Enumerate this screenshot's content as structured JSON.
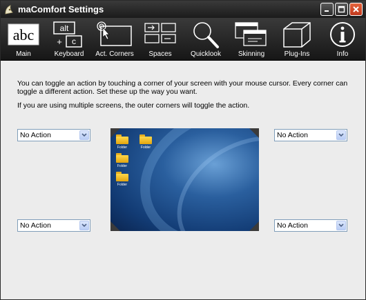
{
  "window": {
    "title": "maComfort Settings"
  },
  "toolbar": {
    "items": [
      {
        "label": "Main",
        "icon": "abc-text-icon"
      },
      {
        "label": "Keyboard",
        "icon": "keyboard-shortcut-icon"
      },
      {
        "label": "Act. Corners",
        "icon": "screen-corner-cursor-icon"
      },
      {
        "label": "Spaces",
        "icon": "spaces-icon"
      },
      {
        "label": "Quicklook",
        "icon": "magnifier-icon"
      },
      {
        "label": "Skinning",
        "icon": "skinning-windows-icon"
      },
      {
        "label": "Plug-Ins",
        "icon": "cube-icon"
      },
      {
        "label": "Info",
        "icon": "info-icon"
      }
    ],
    "main_icon_text": "abc",
    "keyboard_key1": "alt",
    "keyboard_plus": "+",
    "keyboard_key2": "c"
  },
  "content": {
    "paragraph1": "You can toggle an action by touching a corner of your screen with your mouse cursor. Every corner can toggle a different action. Set these up the way you want.",
    "paragraph2": "If you are using multiple screens, the outer corners will toggle the action."
  },
  "corners": {
    "top_left": "No Action",
    "top_right": "No Action",
    "bottom_left": "No Action",
    "bottom_right": "No Action"
  },
  "preview": {
    "folder_label": "Folder"
  }
}
